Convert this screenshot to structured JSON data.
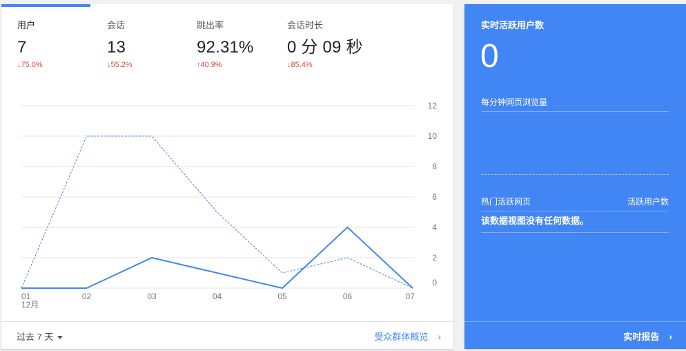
{
  "metrics": [
    {
      "label": "用户",
      "value": "7",
      "change": "↓75.0%",
      "direction": "down"
    },
    {
      "label": "会话",
      "value": "13",
      "change": "↓55.2%",
      "direction": "down"
    },
    {
      "label": "跳出率",
      "value": "92.31%",
      "change": "↑40.9%",
      "direction": "up"
    },
    {
      "label": "会话时长",
      "value": "0 分 09 秒",
      "change": "↓85.4%",
      "direction": "down"
    }
  ],
  "chart_data": {
    "type": "line",
    "categories": [
      "01",
      "02",
      "03",
      "04",
      "05",
      "06",
      "07"
    ],
    "x_sublabel": "12月",
    "ylim": [
      0,
      12
    ],
    "yticks": [
      "12",
      "10",
      "8",
      "6",
      "4",
      "2",
      "0"
    ],
    "series": [
      {
        "values": [
          0,
          0,
          2,
          1,
          0,
          4,
          0
        ],
        "color": "#4285f4",
        "style": "solid"
      },
      {
        "values": [
          0,
          10,
          10,
          5,
          1,
          2,
          0
        ],
        "color": "#4285f4",
        "style": "dashed"
      }
    ],
    "grid": true
  },
  "footer": {
    "range_label": "过去 7 天",
    "overview_link": "受众群体概览",
    "chevron": "›"
  },
  "realtime": {
    "title": "实时活跃用户数",
    "count": "0",
    "pageviews_label": "每分钟网页浏览量",
    "table_col_left": "热门活跃网页",
    "table_col_right": "活跃用户数",
    "empty_message": "该数据视图没有任何数据。",
    "report_link": "实时报告",
    "chevron": "›"
  },
  "colors": {
    "accent": "#4285f4",
    "negative": "#db4437"
  }
}
